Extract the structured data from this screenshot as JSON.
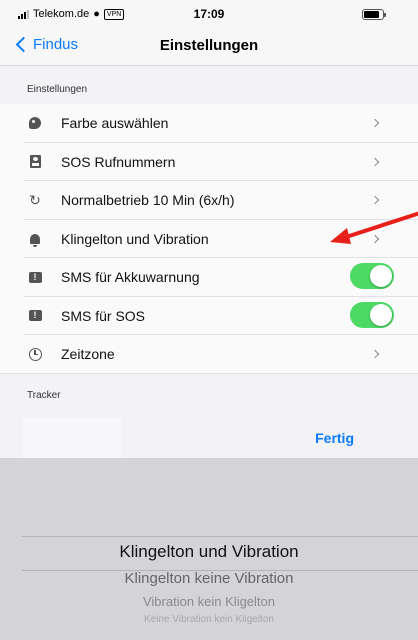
{
  "status_bar": {
    "carrier": "Telekom.de",
    "vpn": "VPN",
    "time": "17:09",
    "battery_level": 0.85
  },
  "nav": {
    "back_label": "Findus",
    "title": "Einstellungen"
  },
  "sections": {
    "settings_header": "Einstellungen",
    "tracker_header": "Tracker"
  },
  "rows": [
    {
      "icon": "palette-icon",
      "label": "Farbe auswählen",
      "accessory": "chevron"
    },
    {
      "icon": "contact-card-icon",
      "label": "SOS Rufnummern",
      "accessory": "chevron"
    },
    {
      "icon": "sync-icon",
      "label": "Normalbetrieb 10 Min (6x/h)",
      "accessory": "chevron"
    },
    {
      "icon": "bell-icon",
      "label": "Klingelton und Vibration",
      "accessory": "chevron"
    },
    {
      "icon": "message-alert-icon",
      "label": "SMS für Akkuwarnung",
      "accessory": "toggle",
      "on": true
    },
    {
      "icon": "message-alert-icon",
      "label": "SMS für SOS",
      "accessory": "toggle",
      "on": true
    },
    {
      "icon": "clock-icon",
      "label": "Zeitzone",
      "accessory": "chevron"
    }
  ],
  "picker": {
    "done_label": "Fertig",
    "options": [
      "Klingelton und Vibration",
      "Klingelton keine Vibration",
      "Vibration kein Kligelton",
      "Keine Vibration kein Kligelton"
    ],
    "selected_index": 0
  },
  "colors": {
    "accent": "#0a7aff",
    "toggle_on": "#4cd964",
    "annotation_arrow": "#e8201a"
  }
}
